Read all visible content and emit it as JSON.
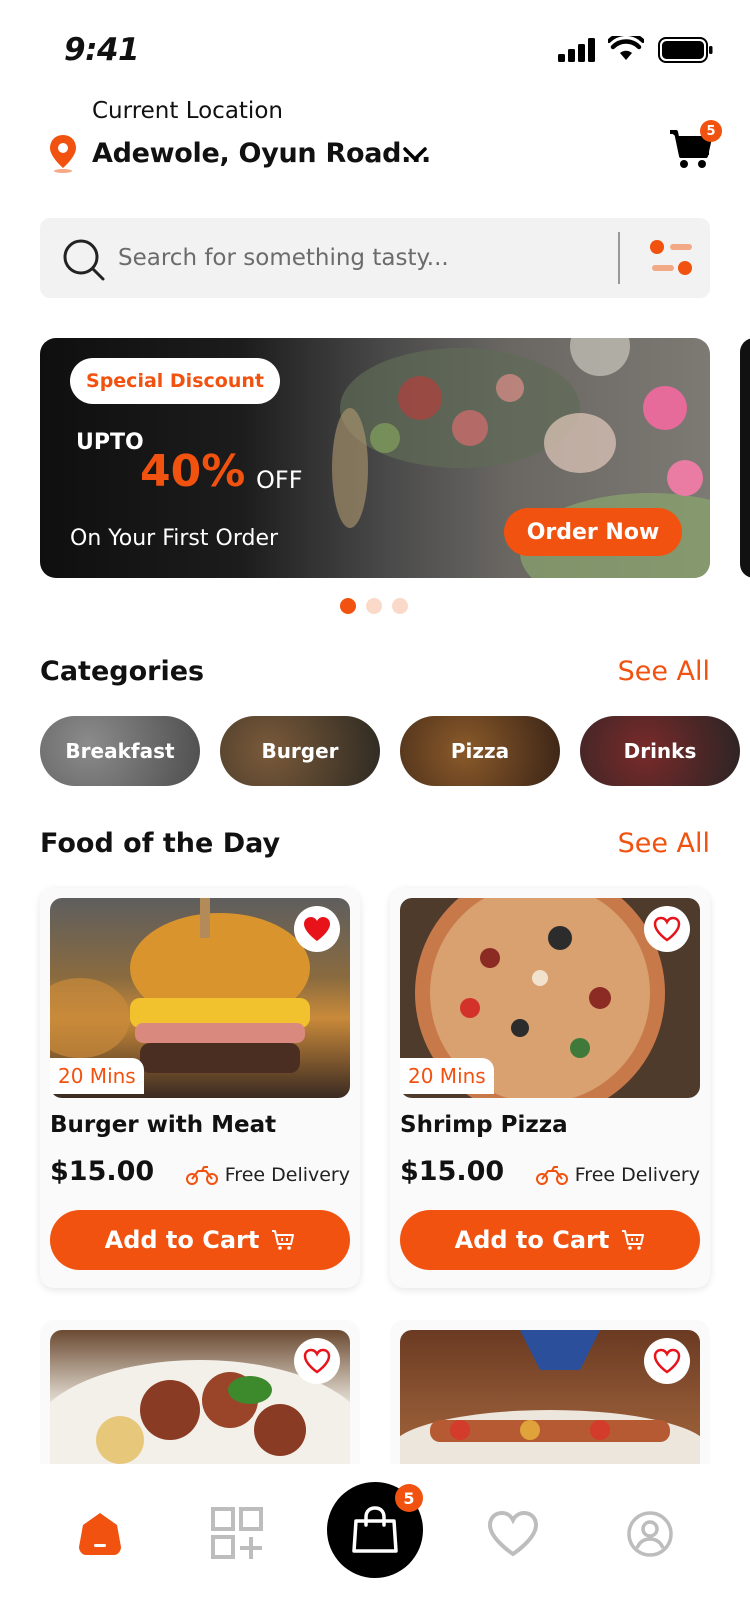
{
  "status_bar": {
    "time": "9:41"
  },
  "header": {
    "location_label": "Current Location",
    "location_value": "Adewole, Oyun Road...",
    "cart_count": "5"
  },
  "search": {
    "placeholder": "Search for something tasty..."
  },
  "banner": {
    "tag": "Special Discount",
    "upto": "UPTO",
    "percent": "40%",
    "off": "OFF",
    "subtitle": "On Your First Order",
    "cta": "Order Now",
    "active_slide": 1,
    "slide_count": 3
  },
  "categories": {
    "title": "Categories",
    "see_all": "See All",
    "items": [
      {
        "label": "Breakfast"
      },
      {
        "label": "Burger"
      },
      {
        "label": "Pizza"
      },
      {
        "label": "Drinks"
      }
    ]
  },
  "food_of_day": {
    "title": "Food of the Day",
    "see_all": "See All",
    "items": [
      {
        "name": "Burger with Meat",
        "time": "20 Mins",
        "price": "$15.00",
        "delivery": "Free Delivery",
        "cta": "Add to Cart",
        "favorited": true
      },
      {
        "name": "Shrimp Pizza",
        "time": "20 Mins",
        "price": "$15.00",
        "delivery": "Free Delivery",
        "cta": "Add to Cart",
        "favorited": false
      }
    ],
    "more_items": [
      {
        "favorited": false
      },
      {
        "favorited": false
      }
    ]
  },
  "bottom_nav": {
    "items": [
      "home-icon",
      "categories-icon",
      "bag-icon",
      "heart-icon",
      "profile-icon"
    ],
    "bag_count": "5",
    "active": "home-icon"
  },
  "colors": {
    "accent": "#F2520F",
    "dark": "#000000",
    "surface": "#F2F2F2"
  }
}
